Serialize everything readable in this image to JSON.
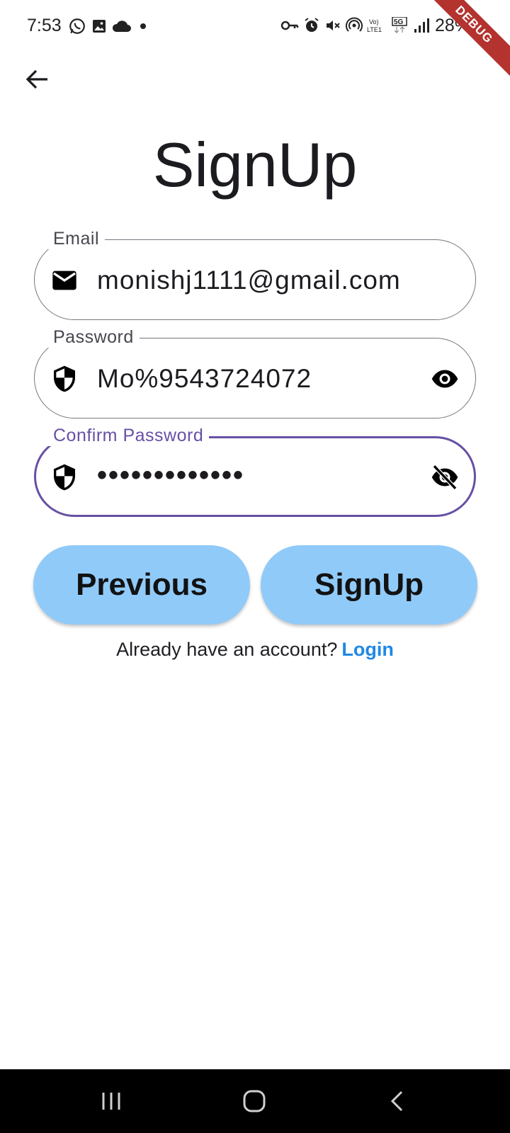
{
  "status_bar": {
    "time": "7:53",
    "battery": "28%",
    "left_icons": [
      "whatsapp-icon",
      "gallery-icon",
      "cloud-icon",
      "dot-icon"
    ],
    "right_icons": [
      "vpn-key-icon",
      "alarm-icon",
      "mute-icon",
      "hotspot-icon",
      "volte-icon",
      "5g-icon",
      "signal-icon"
    ]
  },
  "debug_banner": "DEBUG",
  "title": "SignUp",
  "fields": {
    "email": {
      "label": "Email",
      "value": "monishj1111@gmail.com",
      "icon": "mail-icon"
    },
    "password": {
      "label": "Password",
      "value": "Mo%9543724072",
      "icon": "shield-icon",
      "suffix_icon": "eye-icon"
    },
    "confirm_password": {
      "label": "Confirm Password",
      "value": "•••••••••••••",
      "icon": "shield-icon",
      "suffix_icon": "eye-off-icon"
    }
  },
  "buttons": {
    "previous": "Previous",
    "signup": "SignUp"
  },
  "login_prompt": {
    "text": "Already have an account?",
    "link": "Login"
  },
  "colors": {
    "button_bg": "#90caf9",
    "focus": "#6750a4",
    "link": "#1e88e5",
    "debug": "#b4332f"
  }
}
